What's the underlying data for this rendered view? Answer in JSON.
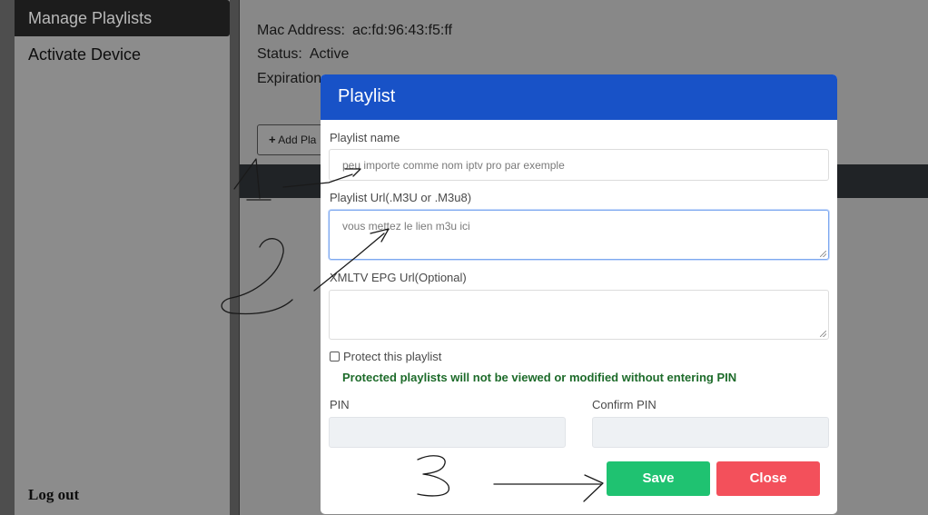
{
  "sidebar": {
    "items": [
      {
        "label": "Manage Playlists",
        "active": true
      },
      {
        "label": "Activate Device",
        "active": false
      }
    ],
    "logout_label": "Log out"
  },
  "main": {
    "mac_label": "Mac Address:",
    "mac_value": "ac:fd:96:43:f5:ff",
    "status_label": "Status:",
    "status_value": "Active",
    "expiration_label": "Expiration",
    "add_button_label": "Add Pla"
  },
  "modal": {
    "title": "Playlist",
    "playlist_name_label": "Playlist name",
    "playlist_name_value": "peu importe comme nom iptv pro par exemple",
    "playlist_url_label": "Playlist Url(.M3U or .M3u8)",
    "playlist_url_value": "vous mettez le lien m3u ici",
    "epg_label": "XMLTV EPG Url(Optional)",
    "epg_value": "",
    "protect_label": "Protect this playlist",
    "protect_checked": false,
    "protect_warning": "Protected playlists will not be viewed or modified without entering PIN",
    "pin_label": "PIN",
    "confirm_pin_label": "Confirm PIN",
    "save_label": "Save",
    "close_label": "Close"
  },
  "colors": {
    "modal_header": "#1852c7",
    "save_button": "#1fc271",
    "close_button": "#f3505b",
    "warning_text": "#1d6b2a"
  }
}
